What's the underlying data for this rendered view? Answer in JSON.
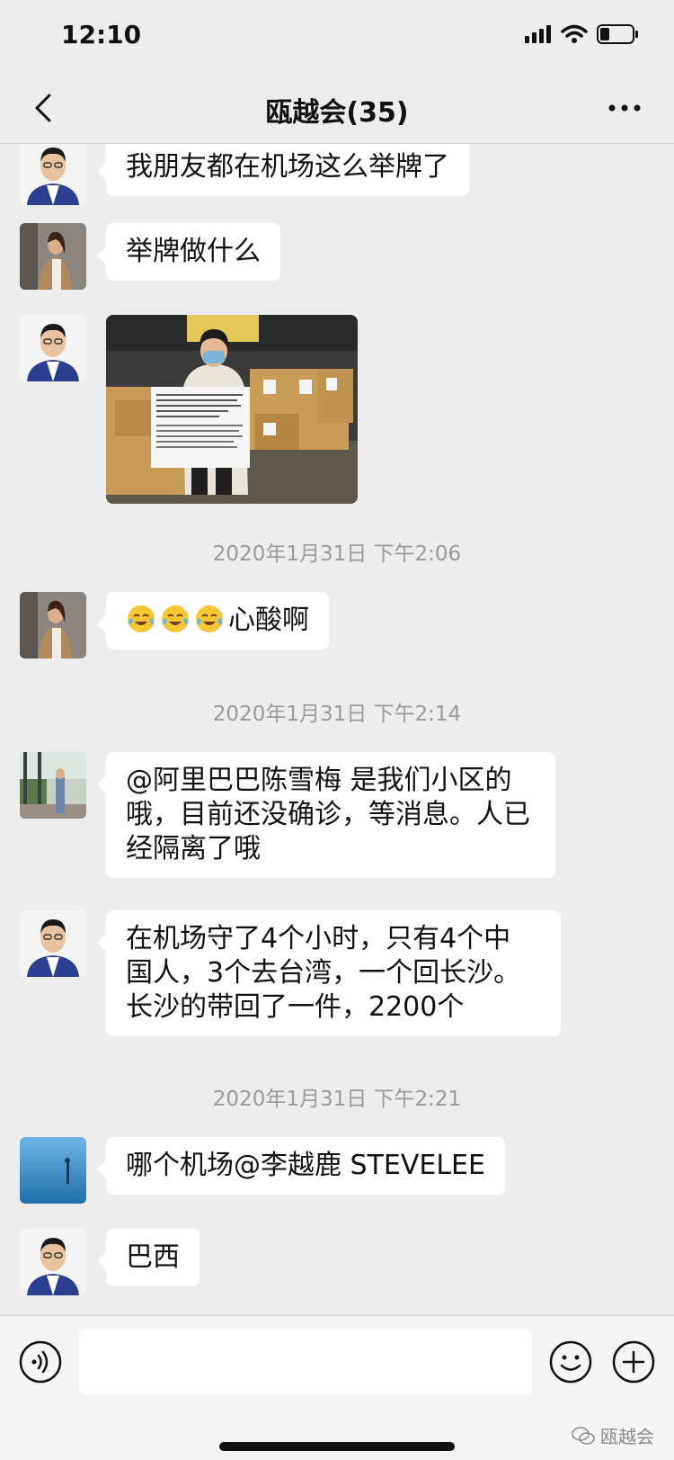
{
  "status_bar": {
    "time": "12:10"
  },
  "nav": {
    "title": "瓯越会(35)",
    "back_icon": "chevron-left-icon",
    "more_icon": "more-dots-icon"
  },
  "messages": [
    {
      "type": "text",
      "sender": "male-avatar",
      "text": "我朋友都在机场这么举牌了"
    },
    {
      "type": "text",
      "sender": "female-avatar",
      "text": "举牌做什么"
    },
    {
      "type": "image",
      "sender": "male-avatar"
    },
    {
      "type": "timestamp",
      "text": "2020年1月31日 下午2:06"
    },
    {
      "type": "text",
      "sender": "female-avatar",
      "emoji_count": 3,
      "emoji_icon": "tears-of-joy-emoji",
      "text": "心酸啊"
    },
    {
      "type": "timestamp",
      "text": "2020年1月31日 下午2:14"
    },
    {
      "type": "text",
      "sender": "outdoor-avatar",
      "lines": [
        "@阿里巴巴陈雪梅 是我们小区的",
        "哦，目前还没确诊，等消息。人已",
        "经隔离了哦"
      ]
    },
    {
      "type": "text",
      "sender": "male-avatar",
      "lines": [
        "在机场守了4个小时，只有4个中",
        "国人，3个去台湾，一个回长沙。",
        "长沙的带回了一件，2200个"
      ]
    },
    {
      "type": "timestamp",
      "text": "2020年1月31日 下午2:21"
    },
    {
      "type": "text",
      "sender": "blue-avatar",
      "text": "哪个机场@李越鹿 STEVELEE"
    },
    {
      "type": "text",
      "sender": "male-avatar",
      "text": "巴西"
    }
  ],
  "input_bar": {
    "voice_icon": "voice-icon",
    "emoji_icon": "smiley-icon",
    "plus_icon": "plus-icon",
    "watermark": "瓯越会"
  },
  "colors": {
    "background": "#ededed",
    "bubble": "#ffffff",
    "timestamp": "#9b9b9b"
  }
}
